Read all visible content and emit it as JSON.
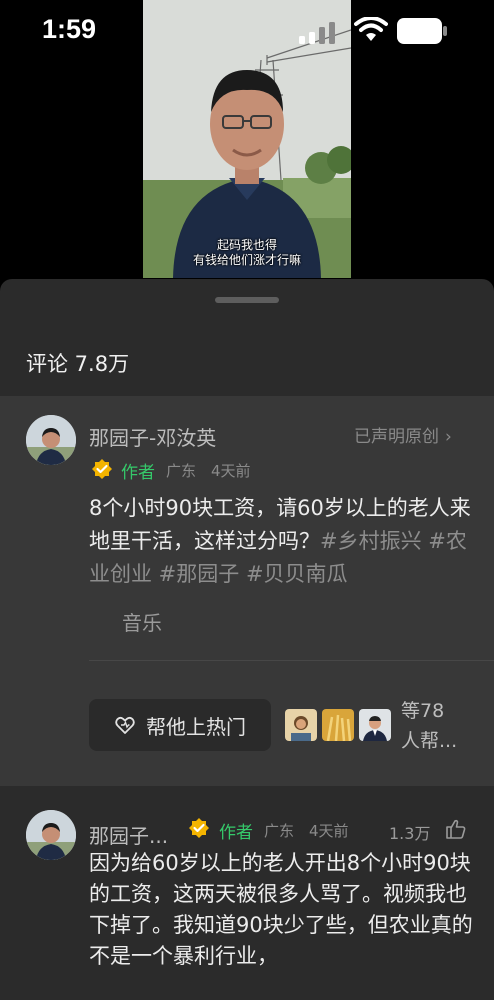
{
  "status": {
    "time": "1:59"
  },
  "video": {
    "subtitle_line1": "起码我也得",
    "subtitle_line2": "有钱给他们涨才行嘛"
  },
  "comments_header": {
    "count_label": "评论 7.8万"
  },
  "author_comment": {
    "name": "那园子-邓汝英",
    "declared": "已声明原创",
    "author_tag": "作者",
    "location": "广东",
    "time": "4天前",
    "text": "8个小时90块工资，请60岁以上的老人来地里干活，这样过分吗？",
    "tags": "#乡村振兴 #农业创业 #那园子 #贝贝南瓜",
    "music": "音乐",
    "boost_label": "帮他上热门",
    "helpers_line1": "等78",
    "helpers_line2": "人帮..."
  },
  "reply_comment": {
    "name": "那园子...",
    "author_tag": "作者",
    "location": "广东",
    "time": "4天前",
    "likes": "1.3万",
    "text": "因为给60岁以上的老人开出8个小时90块的工资，这两天被很多人骂了。视频我也下掉了。我知道90块少了些，但农业真的不是一个暴利行业，"
  },
  "colors": {
    "sheet_bg": "#2b2b2b",
    "highlight_bg": "#383838",
    "author_green": "#35c96a",
    "verified_gold": "#f4b400"
  }
}
